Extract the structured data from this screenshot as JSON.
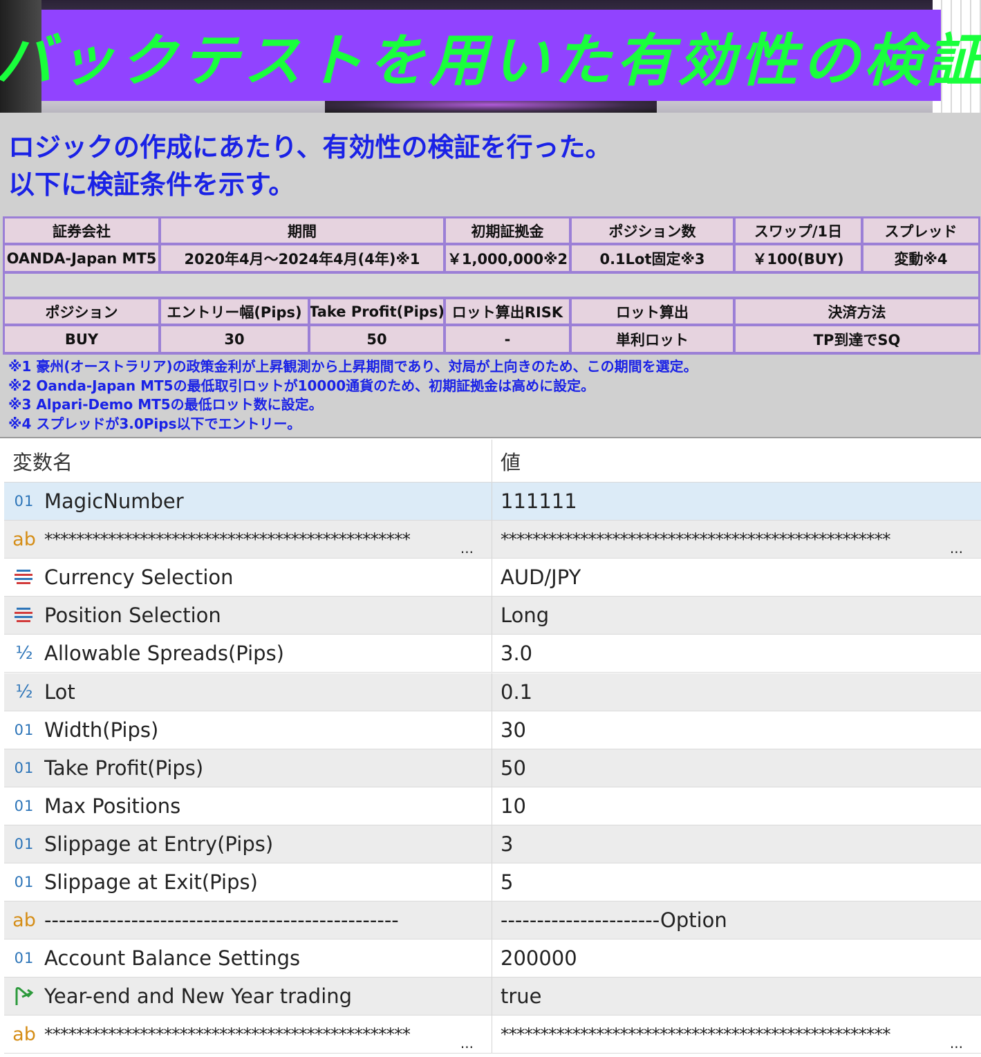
{
  "banner": {
    "title": "バックテストを用いた有効性の検証"
  },
  "intro": {
    "line1": "ロジックの作成にあたり、有効性の検証を行った。",
    "line2": "以下に検証条件を示す。"
  },
  "conditions": {
    "row1_headers": [
      "証券会社",
      "期間",
      "初期証拠金",
      "ポジション数",
      "スワップ/1日",
      "スプレッド"
    ],
    "row1_values": [
      "OANDA-Japan MT5",
      "2020年4月～2024年4月(4年)※1",
      "￥1,000,000※2",
      "0.1Lot固定※3",
      "￥100(BUY)",
      "変動※4"
    ],
    "row2_headers": [
      "ポジション",
      "エントリー幅(Pips)",
      "Take Profit(Pips)",
      "ロット算出RISK",
      "ロット算出",
      "決済方法"
    ],
    "row2_values": [
      "BUY",
      "30",
      "50",
      "-",
      "単利ロット",
      "TP到達でSQ"
    ]
  },
  "notes": [
    "※1 豪州(オーストラリア)の政策金利が上昇観測から上昇期間であり、対局が上向きのため、この期間を選定。",
    "※2 Oanda-Japan MT5の最低取引ロットが10000通貨のため、初期証拠金は高めに設定。",
    "※3 Alpari-Demo MT5の最低ロット数に設定。",
    "※4 スプレッドが3.0Pips以下でエントリー。"
  ],
  "params": {
    "header": {
      "name": "変数名",
      "value": "値"
    },
    "rows": [
      {
        "icon": "int",
        "icon_glyph": "01",
        "name": "MagicNumber",
        "value": "111111"
      },
      {
        "icon": "string",
        "icon_glyph": "ab",
        "name": "**********************************************",
        "value": "*************************************************",
        "ellipsis": "..."
      },
      {
        "icon": "enum",
        "name": "Currency Selection",
        "value": "AUD/JPY"
      },
      {
        "icon": "enum",
        "name": "Position Selection",
        "value": "Long"
      },
      {
        "icon": "double",
        "icon_glyph": "½",
        "name": "Allowable Spreads(Pips)",
        "value": "3.0"
      },
      {
        "icon": "double",
        "icon_glyph": "½",
        "name": "Lot",
        "value": "0.1"
      },
      {
        "icon": "int",
        "icon_glyph": "01",
        "name": "Width(Pips)",
        "value": "30"
      },
      {
        "icon": "int",
        "icon_glyph": "01",
        "name": "Take Profit(Pips)",
        "value": "50"
      },
      {
        "icon": "int",
        "icon_glyph": "01",
        "name": "Max Positions",
        "value": "10"
      },
      {
        "icon": "int",
        "icon_glyph": "01",
        "name": "Slippage at Entry(Pips)",
        "value": "3"
      },
      {
        "icon": "int",
        "icon_glyph": "01",
        "name": "Slippage at Exit(Pips)",
        "value": "5"
      },
      {
        "icon": "string",
        "icon_glyph": "ab",
        "name": "-------------------------------------------------",
        "value": "----------------------Option"
      },
      {
        "icon": "int",
        "icon_glyph": "01",
        "name": "Account Balance Settings",
        "value": "200000"
      },
      {
        "icon": "bool",
        "name": "Year-end and New Year trading",
        "value": "true"
      },
      {
        "icon": "string",
        "icon_glyph": "ab",
        "name": "**********************************************",
        "value": "*************************************************",
        "ellipsis": "..."
      }
    ]
  },
  "colors": {
    "banner_box": "#9143ff",
    "banner_text": "#19ff3c",
    "intro_text": "#1a22e6",
    "table_border": "#9b7fd6",
    "table_cell": "#e6d3df",
    "row_selected": "#dcebf7",
    "row_alt": "#ececec",
    "int_icon": "#2c74b8",
    "string_icon": "#d58d16",
    "enum_icon_a": "#2c74b8",
    "enum_icon_b": "#d23b3b",
    "bool_icon": "#2c9a3c"
  }
}
